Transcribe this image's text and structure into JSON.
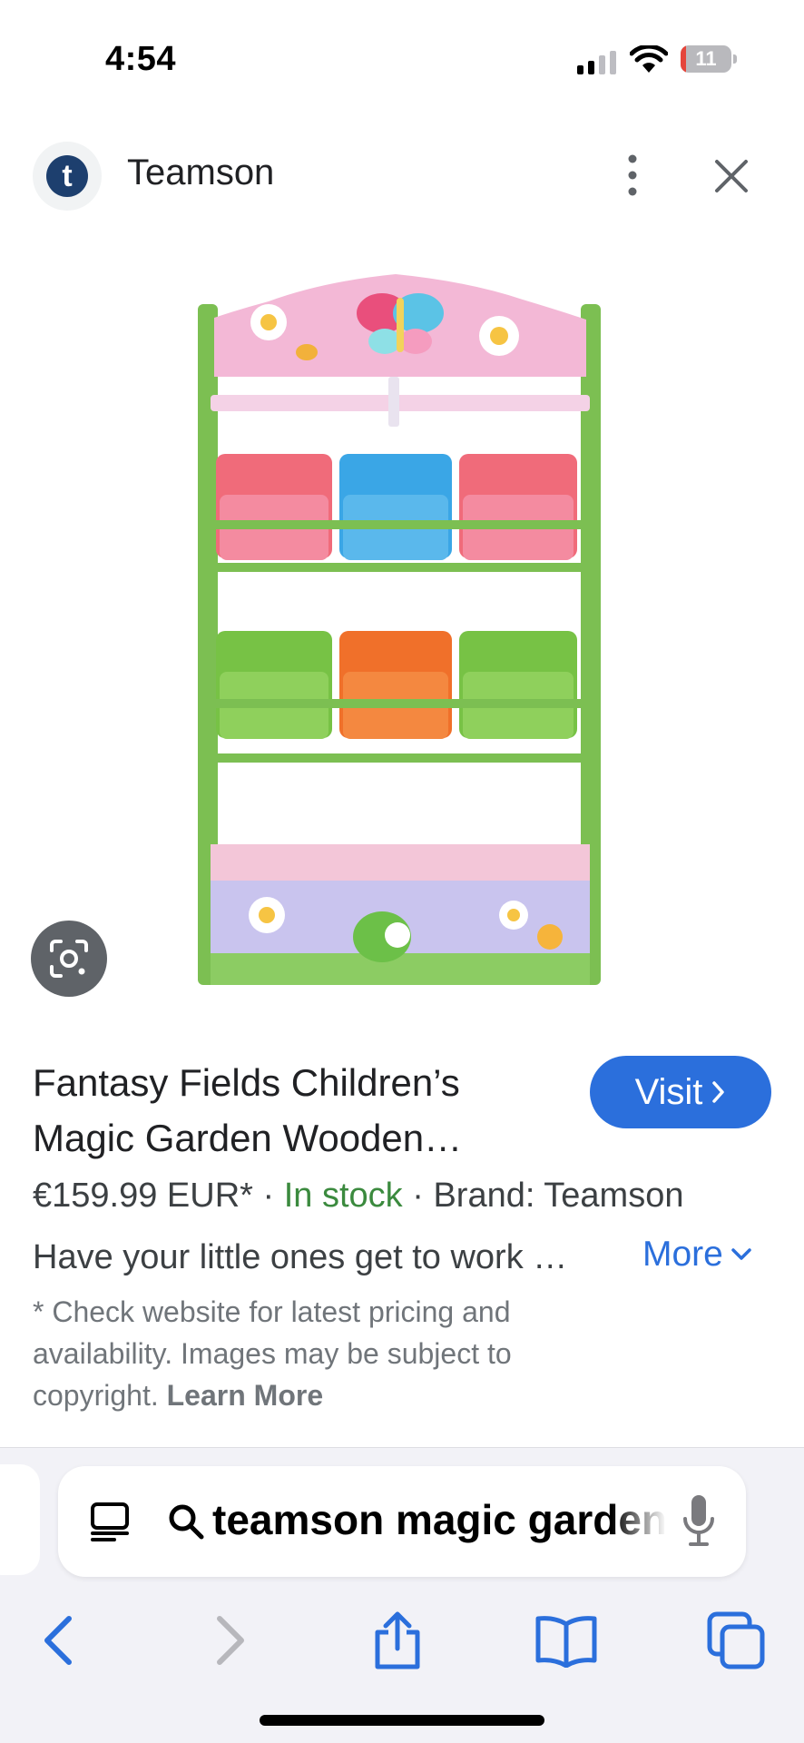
{
  "status_bar": {
    "time": "4:54",
    "battery_level": "11",
    "battery_fraction": 0.11
  },
  "header": {
    "logo_letter": "t",
    "site_name": "Teamson"
  },
  "product": {
    "title": "Fantasy Fields Children’s Magic Garden Wooden…",
    "visit_label": "Visit",
    "price": "€159.99 EUR*",
    "separator": " · ",
    "stock": "In stock",
    "brand": "Brand: Teamson",
    "description": "Have your little ones get to work …",
    "more_label": "More",
    "disclaimer": "* Check website for latest pricing and availability. Images may be subject to copyright.",
    "learn_more": "Learn More"
  },
  "browser": {
    "address_text": "teamson magic garden"
  },
  "colors": {
    "accent_blue": "#2b6fdc",
    "stock_green": "#3b8a3e",
    "battery_red": "#e5453b"
  },
  "icons": {
    "signal": "cellular-signal-icon",
    "wifi": "wifi-icon",
    "menu": "more-vert-icon",
    "close": "close-icon",
    "lens": "google-lens-icon",
    "reader": "reader-icon",
    "search": "search-icon",
    "mic": "microphone-icon",
    "back": "back-arrow-icon",
    "forward": "forward-arrow-icon",
    "share": "share-icon",
    "bookmarks": "bookmarks-icon",
    "tabs": "tabs-icon"
  }
}
